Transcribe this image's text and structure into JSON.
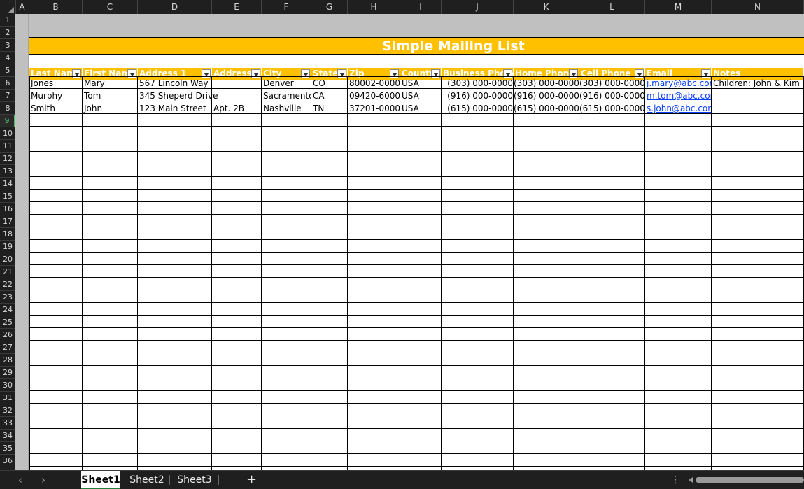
{
  "columns": [
    "A",
    "B",
    "C",
    "D",
    "E",
    "F",
    "G",
    "H",
    "I",
    "J",
    "K",
    "L",
    "M",
    "N"
  ],
  "rows": [
    "1",
    "2",
    "3",
    "4",
    "5",
    "6",
    "7",
    "8",
    "9",
    "10",
    "11",
    "12",
    "13",
    "14",
    "15",
    "16",
    "17",
    "18",
    "19",
    "20",
    "21",
    "22",
    "23",
    "24",
    "25",
    "26",
    "27",
    "28",
    "29",
    "30",
    "31",
    "32",
    "33",
    "34",
    "35",
    "36"
  ],
  "selected_row": "9",
  "title": "Simple Mailing List",
  "headers": [
    "Last Name",
    "First Name",
    "Address 1",
    "Address",
    "City",
    "State",
    "Zip",
    "Country",
    "Business Phone",
    "Home Phone",
    "Cell Phone",
    "Email",
    "Notes"
  ],
  "records": [
    {
      "last": "Jones",
      "first": "Mary",
      "address1": "567 Lincoln Way",
      "address2": "",
      "city": "Denver",
      "state": "CO",
      "zip": "80002-0000",
      "country": "USA",
      "business": "(303) 000-0000",
      "home": "(303) 000-0000",
      "cell": "(303) 000-0000",
      "email": "j.mary@abc.com",
      "notes": "Children: John & Kim"
    },
    {
      "last": "Murphy",
      "first": "Tom",
      "address1": "345 Sheperd Drive",
      "address2": "",
      "city": "Sacramento",
      "state": "CA",
      "zip": "09420-6000",
      "country": "USA",
      "business": "(916) 000-0000",
      "home": "(916) 000-0000",
      "cell": "(916) 000-0000",
      "email": "m.tom@abc.com",
      "notes": ""
    },
    {
      "last": "Smith",
      "first": "John",
      "address1": "123 Main Street",
      "address2": "Apt. 2B",
      "city": "Nashville",
      "state": "TN",
      "zip": "37201-0000",
      "country": "USA",
      "business": "(615) 000-0000",
      "home": "(615) 000-0000",
      "cell": "(615) 000-0000",
      "email": "s.john@abc.com",
      "notes": ""
    }
  ],
  "tabs": [
    {
      "label": "Sheet1",
      "active": true
    },
    {
      "label": "Sheet2",
      "active": false
    },
    {
      "label": "Sheet3",
      "active": false
    }
  ],
  "add_sheet_label": "+",
  "more_label": "⋮",
  "nav_prev": "‹",
  "nav_next": "›",
  "colors": {
    "accent": "#ffc000",
    "link": "#0b3fff",
    "sheet_gray": "#c0c0c0",
    "active_tab_underline": "#1e7f3b"
  }
}
